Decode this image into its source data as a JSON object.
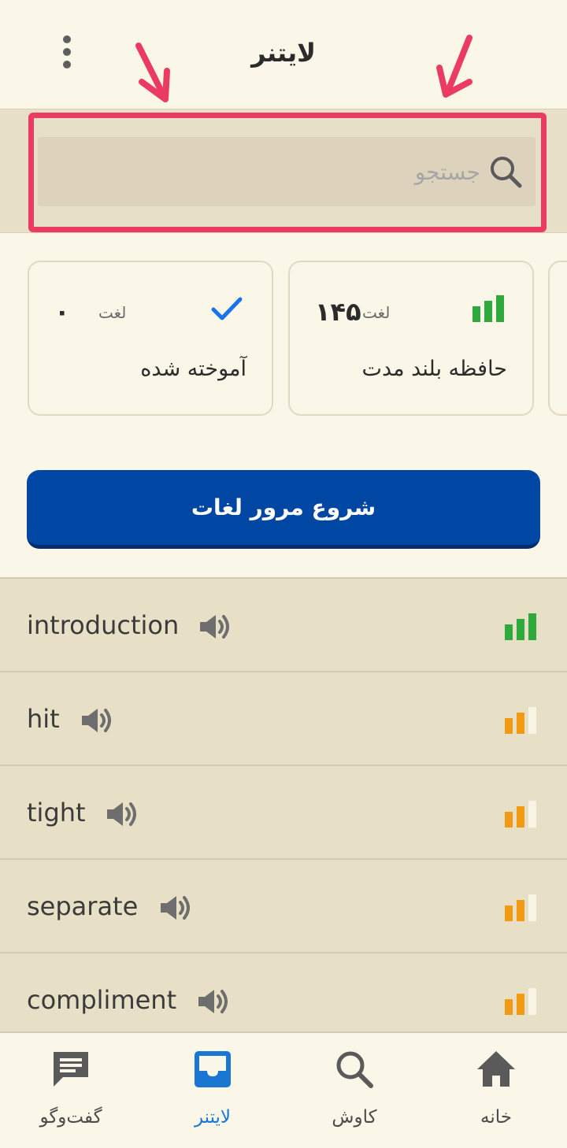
{
  "header": {
    "title": "لایتنر",
    "menu_icon": "more-vertical-icon"
  },
  "search": {
    "placeholder": "جستجو",
    "value": "",
    "icon": "search-icon"
  },
  "cards": [
    {
      "name": "آموخته شده",
      "count": "۰",
      "unit": "لغت",
      "icon": "checkmark-icon",
      "icon_color": "#1a73e8"
    },
    {
      "name": "حافظه بلند مدت",
      "count": "۱۴۵",
      "unit": "لغت",
      "icon": "signal-bars-icon",
      "icon_color": "#2eaa3c"
    }
  ],
  "review_button": {
    "label": "شروع مرور لغات",
    "color": "#0047a3"
  },
  "words": [
    {
      "word": "introduction",
      "level_bars_filled": 3,
      "level_color": "#2eaa3c"
    },
    {
      "word": "hit",
      "level_bars_filled": 2,
      "level_color": "#f29a14"
    },
    {
      "word": "tight",
      "level_bars_filled": 2,
      "level_color": "#f29a14"
    },
    {
      "word": "separate",
      "level_bars_filled": 2,
      "level_color": "#f29a14"
    },
    {
      "word": "compliment",
      "level_bars_filled": 2,
      "level_color": "#f29a14"
    }
  ],
  "bottom_nav": {
    "items": [
      {
        "label": "گفت‌وگو",
        "icon": "chat-icon",
        "active": false
      },
      {
        "label": "لایتنر",
        "icon": "inbox-icon",
        "active": true
      },
      {
        "label": "کاوش",
        "icon": "search-icon",
        "active": false
      },
      {
        "label": "خانه",
        "icon": "home-icon",
        "active": false
      }
    ],
    "active_color": "#1976d2"
  },
  "colors": {
    "background": "#faf7e9",
    "band": "#e8dfc8",
    "highlight": "#ea3b63"
  }
}
